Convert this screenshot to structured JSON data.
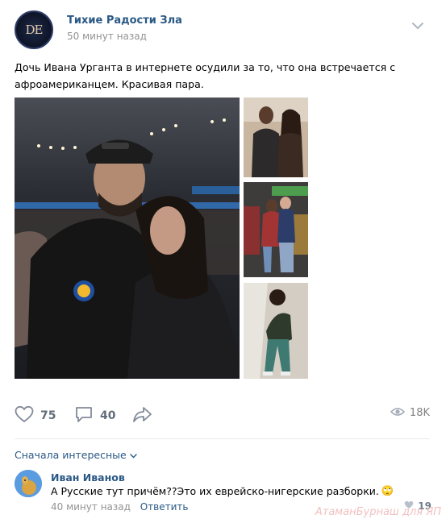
{
  "post": {
    "group_name": "Тихие Радости Зла",
    "avatar_monogram": "DE",
    "time": "50 минут назад",
    "text": "Дочь Ивана Урганта в интернете осудили за то, что она встречается с афроамериканцем. Красивая пара.",
    "menu_icon": "chevron-down-icon"
  },
  "actions": {
    "likes": "75",
    "comments": "40",
    "views": "18K",
    "like_icon": "heart-icon",
    "comment_icon": "comment-icon",
    "share_icon": "share-icon",
    "views_icon": "eye-icon"
  },
  "comments": {
    "sort_label": "Сначала интересные",
    "items": [
      {
        "author": "Иван Иванов",
        "text": "А Русские тут причём??Это их еврейско-нигерские разборки.",
        "emoji": "🙄",
        "time": "40 минут назад",
        "reply_label": "Ответить",
        "likes": "19"
      }
    ]
  },
  "watermark": "АтаманБурнаш для ЯП",
  "colors": {
    "link": "#2a5885",
    "muted": "#939393",
    "icon": "#828a99",
    "divider": "#e7e8ec"
  }
}
